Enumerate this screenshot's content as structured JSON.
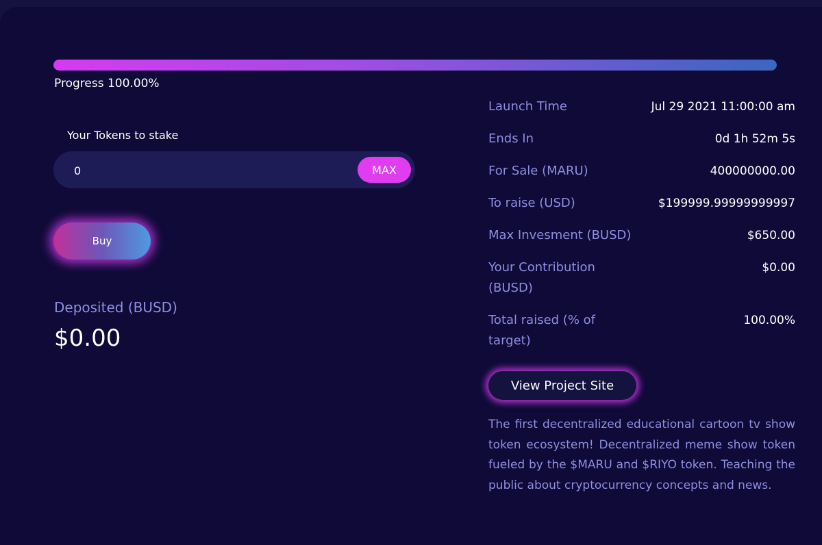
{
  "progress": {
    "label": "Progress 100.00%",
    "fraction": 1.0
  },
  "stake": {
    "label": "Your Tokens to stake",
    "input_value": "0",
    "max_label": "MAX"
  },
  "buy_label": "Buy",
  "deposited": {
    "label": "Deposited (BUSD)",
    "value": "$0.00"
  },
  "info": [
    {
      "label": "Launch Time",
      "value": "Jul 29 2021 11:00:00 am"
    },
    {
      "label": "Ends In",
      "value": "0d 1h 52m 5s"
    },
    {
      "label": "For Sale (MARU)",
      "value": "400000000.00"
    },
    {
      "label": "To raise (USD)",
      "value": "$199999.99999999997"
    },
    {
      "label": "Max Invesment (BUSD)",
      "value": "$650.00"
    },
    {
      "label": "Your Contribution (BUSD)",
      "value": "$0.00"
    },
    {
      "label": "Total raised (% of target)",
      "value": "100.00%"
    }
  ],
  "project_site_label": "View Project Site",
  "description": "The first decentralized educational cartoon tv show token ecosystem! Decentralized meme show token fueled by the $MARU and $RIYO token. Teaching the public about cryptocurrency concepts and news.",
  "colors": {
    "background": "#0f0a38",
    "accent": "#e03cf0",
    "label": "#8f8fe0"
  }
}
